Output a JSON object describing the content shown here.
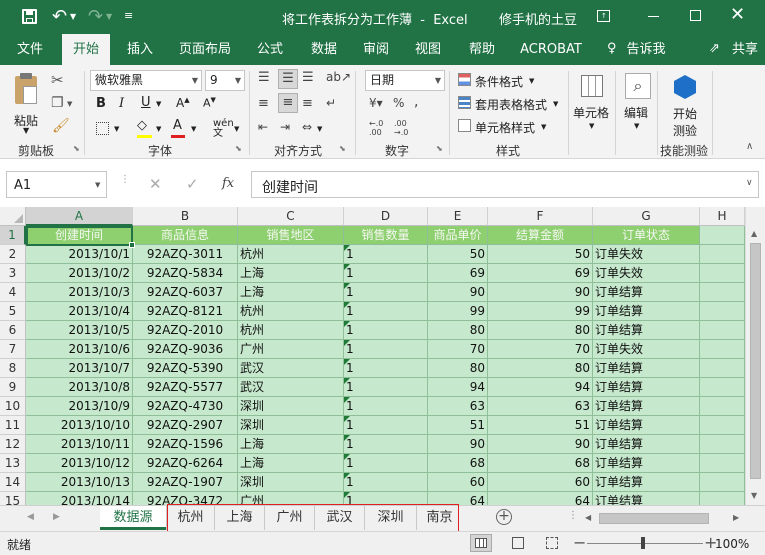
{
  "titlebar": {
    "title": "将工作表拆分为工作薄  -  Excel",
    "user": "修手机的土豆"
  },
  "tabs": [
    "文件",
    "开始",
    "插入",
    "页面布局",
    "公式",
    "数据",
    "审阅",
    "视图",
    "帮助",
    "ACROBAT",
    "告诉我",
    "共享"
  ],
  "ribbon": {
    "clipboard": {
      "paste": "粘贴",
      "label": "剪贴板"
    },
    "font": {
      "name": "微软雅黑",
      "size": "9",
      "label": "字体"
    },
    "alignment": {
      "label": "对齐方式"
    },
    "number": {
      "format": "日期",
      "label": "数字"
    },
    "styles": {
      "conditional": "条件格式",
      "table": "套用表格格式",
      "cell": "单元格样式",
      "label": "样式"
    },
    "cells": {
      "label": "单元格"
    },
    "editing": {
      "label": "编辑"
    },
    "addin": {
      "line1": "开始",
      "line2": "测验",
      "label": "技能测验"
    }
  },
  "formula_bar": {
    "name_box": "A1",
    "fx": "fx",
    "content": "创建时间"
  },
  "columns": [
    "A",
    "B",
    "C",
    "D",
    "E",
    "F",
    "G",
    "H"
  ],
  "header_row": [
    "创建时间",
    "商品信息",
    "销售地区",
    "销售数量",
    "商品单价",
    "结算金额",
    "订单状态"
  ],
  "rows": [
    [
      "2013/10/1",
      "92AZQ-3011",
      "杭州",
      "1",
      "50",
      "50",
      "订单失效"
    ],
    [
      "2013/10/2",
      "92AZQ-5834",
      "上海",
      "1",
      "69",
      "69",
      "订单失效"
    ],
    [
      "2013/10/3",
      "92AZQ-6037",
      "上海",
      "1",
      "90",
      "90",
      "订单结算"
    ],
    [
      "2013/10/4",
      "92AZQ-8121",
      "杭州",
      "1",
      "99",
      "99",
      "订单结算"
    ],
    [
      "2013/10/5",
      "92AZQ-2010",
      "杭州",
      "1",
      "80",
      "80",
      "订单结算"
    ],
    [
      "2013/10/6",
      "92AZQ-9036",
      "广州",
      "1",
      "70",
      "70",
      "订单失效"
    ],
    [
      "2013/10/7",
      "92AZQ-5390",
      "武汉",
      "1",
      "80",
      "80",
      "订单结算"
    ],
    [
      "2013/10/8",
      "92AZQ-5577",
      "武汉",
      "1",
      "94",
      "94",
      "订单结算"
    ],
    [
      "2013/10/9",
      "92AZQ-4730",
      "深圳",
      "1",
      "63",
      "63",
      "订单结算"
    ],
    [
      "2013/10/10",
      "92AZQ-2907",
      "深圳",
      "1",
      "51",
      "51",
      "订单结算"
    ],
    [
      "2013/10/11",
      "92AZQ-1596",
      "上海",
      "1",
      "90",
      "90",
      "订单结算"
    ],
    [
      "2013/10/12",
      "92AZQ-6264",
      "上海",
      "1",
      "68",
      "68",
      "订单结算"
    ],
    [
      "2013/10/13",
      "92AZQ-1907",
      "深圳",
      "1",
      "60",
      "60",
      "订单结算"
    ],
    [
      "2013/10/14",
      "92AZQ-3472",
      "广州",
      "1",
      "64",
      "64",
      "订单结算"
    ]
  ],
  "row_numbers": [
    "1",
    "2",
    "3",
    "4",
    "5",
    "6",
    "7",
    "8",
    "9",
    "10",
    "11",
    "12",
    "13",
    "14",
    "15"
  ],
  "sheets": [
    "数据源",
    "杭州",
    "上海",
    "广州",
    "武汉",
    "深圳",
    "南京"
  ],
  "status": {
    "ready": "就绪",
    "zoom": "100%"
  },
  "colors": {
    "excel_green": "#217346",
    "header_fill": "#8ecf6f",
    "data_fill": "#c6e8cd",
    "highlight_box": "#e02020"
  }
}
